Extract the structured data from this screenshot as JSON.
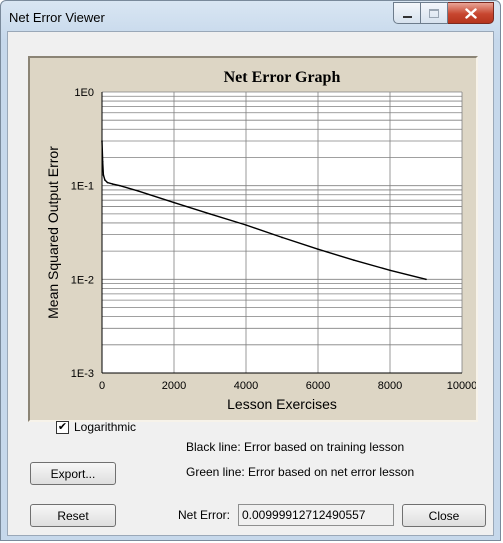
{
  "window": {
    "title": "Net Error Viewer",
    "controls": {
      "minimize_icon": "minimize-icon",
      "maximize_icon": "maximize-icon",
      "close_icon": "close-icon"
    }
  },
  "chart_data": {
    "type": "line",
    "title": "Net Error Graph",
    "xlabel": "Lesson Exercises",
    "ylabel": "Mean Squared Output Error",
    "xlim": [
      0,
      10000
    ],
    "ylim": [
      0.001,
      1
    ],
    "yscale": "log",
    "x_ticks": [
      "0",
      "2000",
      "4000",
      "6000",
      "8000",
      "10000"
    ],
    "y_ticks": [
      "1E0",
      "1E-1",
      "1E-2",
      "1E-3"
    ],
    "grid": true,
    "series": [
      {
        "color": "#000000",
        "x": [
          0,
          20,
          40,
          80,
          150,
          300,
          500,
          1000,
          2000,
          3000,
          4000,
          5000,
          6000,
          7000,
          8000,
          9000
        ],
        "y": [
          0.3,
          0.18,
          0.13,
          0.115,
          0.108,
          0.104,
          0.1,
          0.088,
          0.066,
          0.05,
          0.038,
          0.028,
          0.021,
          0.016,
          0.0125,
          0.01
        ]
      }
    ],
    "colors": {
      "panel": "#ddd6c5",
      "plot": "#ffffff",
      "grid": "#808080",
      "line": "#000000"
    }
  },
  "options": {
    "logarithmic_label": "Logarithmic",
    "logarithmic_checked": true,
    "check_glyph": "✔"
  },
  "legend": {
    "black_line": "Black line: Error based on training lesson",
    "green_line": "Green line: Error based on net error lesson"
  },
  "buttons": {
    "export": "Export...",
    "reset": "Reset",
    "close": "Close"
  },
  "net_error": {
    "label": "Net Error:",
    "value": "0.00999912712490557"
  }
}
